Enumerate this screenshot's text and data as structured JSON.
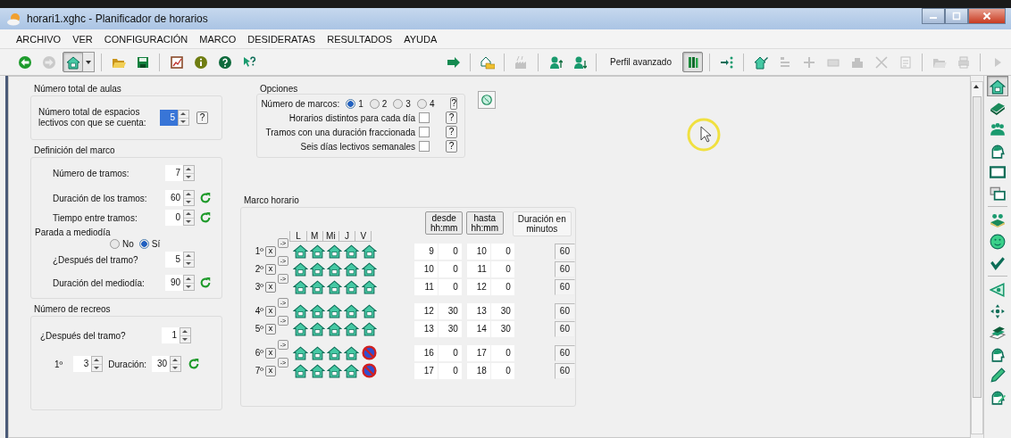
{
  "window": {
    "title": "horari1.xghc - Planificador de horarios"
  },
  "menu": [
    {
      "label": "ARCHIVO"
    },
    {
      "label": "VER"
    },
    {
      "label": "CONFIGURACIÓN"
    },
    {
      "label": "MARCO"
    },
    {
      "label": "DESIDERATAS"
    },
    {
      "label": "RESULTADOS"
    },
    {
      "label": "AYUDA"
    }
  ],
  "toolbar": {
    "left": [
      {
        "kind": "icon",
        "disabled": false,
        "selected": false
      },
      {
        "kind": "icon",
        "disabled": true,
        "selected": false
      },
      {
        "kind": "icon",
        "disabled": false,
        "selected": true
      },
      {
        "kind": "dropdown"
      },
      {
        "kind": "separator"
      },
      {
        "kind": "icon",
        "disabled": false,
        "selected": false
      },
      {
        "kind": "icon",
        "disabled": false,
        "selected": false
      },
      {
        "kind": "separator"
      },
      {
        "kind": "icon",
        "disabled": false,
        "selected": false
      },
      {
        "kind": "icon",
        "disabled": false,
        "selected": false
      },
      {
        "kind": "icon",
        "disabled": false,
        "selected": false
      },
      {
        "kind": "icon",
        "disabled": false,
        "selected": false
      }
    ],
    "right": [
      {
        "kind": "icon",
        "disabled": false,
        "selected": false
      },
      {
        "kind": "separator"
      },
      {
        "kind": "icon",
        "disabled": false,
        "selected": false
      },
      {
        "kind": "separator"
      },
      {
        "kind": "icon",
        "disabled": true,
        "selected": false
      },
      {
        "kind": "separator"
      },
      {
        "kind": "icon",
        "disabled": false,
        "selected": false
      },
      {
        "kind": "icon",
        "disabled": false,
        "selected": false
      },
      {
        "kind": "separator"
      },
      {
        "kind": "label",
        "text": "Perfil avanzado"
      },
      {
        "kind": "icon",
        "disabled": false,
        "selected": true
      },
      {
        "kind": "separator"
      },
      {
        "kind": "icon",
        "disabled": false,
        "selected": false
      },
      {
        "kind": "separator"
      },
      {
        "kind": "icon",
        "disabled": false,
        "selected": false
      },
      {
        "kind": "icon",
        "disabled": true,
        "selected": false
      },
      {
        "kind": "icon",
        "disabled": true,
        "selected": false
      },
      {
        "kind": "icon",
        "disabled": true,
        "selected": false
      },
      {
        "kind": "icon",
        "disabled": true,
        "selected": false
      },
      {
        "kind": "icon",
        "disabled": true,
        "selected": false
      },
      {
        "kind": "icon",
        "disabled": true,
        "selected": false
      },
      {
        "kind": "separator"
      },
      {
        "kind": "icon",
        "disabled": true,
        "selected": false
      },
      {
        "kind": "icon",
        "disabled": true,
        "selected": false
      },
      {
        "kind": "separator"
      },
      {
        "kind": "icon",
        "disabled": true,
        "selected": false
      }
    ]
  },
  "aulas": {
    "title": "Número total de aulas",
    "label": "Número total de espacios lectivos con que se cuenta:",
    "value": "5",
    "help": "?"
  },
  "marco": {
    "title": "Definición del marco",
    "rows": [
      {
        "label": "Número de tramos:",
        "value": "7",
        "refresh": false
      },
      {
        "label": "Duración de los tramos:",
        "value": "60",
        "refresh": true
      },
      {
        "label": "Tiempo entre tramos:",
        "value": "0",
        "refresh": true
      }
    ]
  },
  "parada": {
    "title": "Parada a mediodía",
    "options": [
      {
        "label": "No",
        "selected": false
      },
      {
        "label": "Sí",
        "selected": true
      }
    ],
    "rows": [
      {
        "label": "¿Después del tramo?",
        "value": "5",
        "refresh": false
      },
      {
        "label": "Duración del mediodía:",
        "value": "90",
        "refresh": true
      }
    ]
  },
  "recreos": {
    "title": "Número de recreos",
    "count": "1",
    "label": "¿Después del tramo?",
    "items": [
      {
        "ordinal": "1º",
        "value": "3",
        "duration_label": "Duración:",
        "duration": "30"
      }
    ]
  },
  "opciones": {
    "title": "Opciones",
    "marcos_label": "Número de marcos:",
    "marcos": [
      {
        "label": "1",
        "selected": true
      },
      {
        "label": "2",
        "selected": false
      },
      {
        "label": "3",
        "selected": false
      },
      {
        "label": "4",
        "selected": false
      }
    ],
    "help": "?",
    "checks": [
      {
        "label": "Horarios distintos para cada día",
        "checked": false,
        "help": "?"
      },
      {
        "label": "Tramos con una duración fraccionada",
        "checked": false,
        "help": "?"
      },
      {
        "label": "Seis días lectivos semanales",
        "checked": false,
        "help": "?"
      }
    ]
  },
  "horario": {
    "title": "Marco horario",
    "days": [
      "L",
      "M",
      "Mi",
      "J",
      "V"
    ],
    "desde": [
      "desde",
      "hh:mm"
    ],
    "hasta": [
      "hasta",
      "hh:mm"
    ],
    "duracion": [
      "Duración en",
      "minutos"
    ],
    "rows": [
      {
        "ordinal": "1º",
        "clear": "x",
        "arrow": "->",
        "gap_before": false,
        "days": [
          true,
          true,
          true,
          true,
          true
        ],
        "from_h": "9",
        "from_m": "0",
        "to_h": "10",
        "to_m": "0",
        "duration": "60"
      },
      {
        "ordinal": "2º",
        "clear": "x",
        "arrow": "->",
        "gap_before": false,
        "days": [
          true,
          true,
          true,
          true,
          true
        ],
        "from_h": "10",
        "from_m": "0",
        "to_h": "11",
        "to_m": "0",
        "duration": "60"
      },
      {
        "ordinal": "3º",
        "clear": "x",
        "arrow": "->",
        "gap_before": false,
        "days": [
          true,
          true,
          true,
          true,
          true
        ],
        "from_h": "11",
        "from_m": "0",
        "to_h": "12",
        "to_m": "0",
        "duration": "60"
      },
      {
        "ordinal": "4º",
        "clear": "x",
        "arrow": "->",
        "gap_before": true,
        "days": [
          true,
          true,
          true,
          true,
          true
        ],
        "from_h": "12",
        "from_m": "30",
        "to_h": "13",
        "to_m": "30",
        "duration": "60"
      },
      {
        "ordinal": "5º",
        "clear": "x",
        "arrow": "->",
        "gap_before": false,
        "days": [
          true,
          true,
          true,
          true,
          true
        ],
        "from_h": "13",
        "from_m": "30",
        "to_h": "14",
        "to_m": "30",
        "duration": "60"
      },
      {
        "ordinal": "6º",
        "clear": "x",
        "arrow": "->",
        "gap_before": true,
        "days": [
          true,
          true,
          true,
          true,
          false
        ],
        "from_h": "16",
        "from_m": "0",
        "to_h": "17",
        "to_m": "0",
        "duration": "60"
      },
      {
        "ordinal": "7º",
        "clear": "x",
        "arrow": "->",
        "gap_before": false,
        "days": [
          true,
          true,
          true,
          true,
          false
        ],
        "from_h": "17",
        "from_m": "0",
        "to_h": "18",
        "to_m": "0",
        "duration": "60"
      }
    ]
  },
  "sidebar": [
    {
      "kind": "icon",
      "selected": true
    },
    {
      "kind": "icon",
      "selected": false
    },
    {
      "kind": "icon",
      "selected": false
    },
    {
      "kind": "icon",
      "selected": false
    },
    {
      "kind": "icon",
      "selected": false
    },
    {
      "kind": "icon",
      "selected": false
    },
    {
      "kind": "separator"
    },
    {
      "kind": "icon",
      "selected": false
    },
    {
      "kind": "icon",
      "selected": false
    },
    {
      "kind": "icon",
      "selected": false
    },
    {
      "kind": "separator"
    },
    {
      "kind": "icon",
      "selected": false
    },
    {
      "kind": "icon",
      "selected": false
    },
    {
      "kind": "icon",
      "selected": false
    },
    {
      "kind": "icon",
      "selected": false
    },
    {
      "kind": "icon",
      "selected": false
    },
    {
      "kind": "icon",
      "selected": false
    }
  ]
}
